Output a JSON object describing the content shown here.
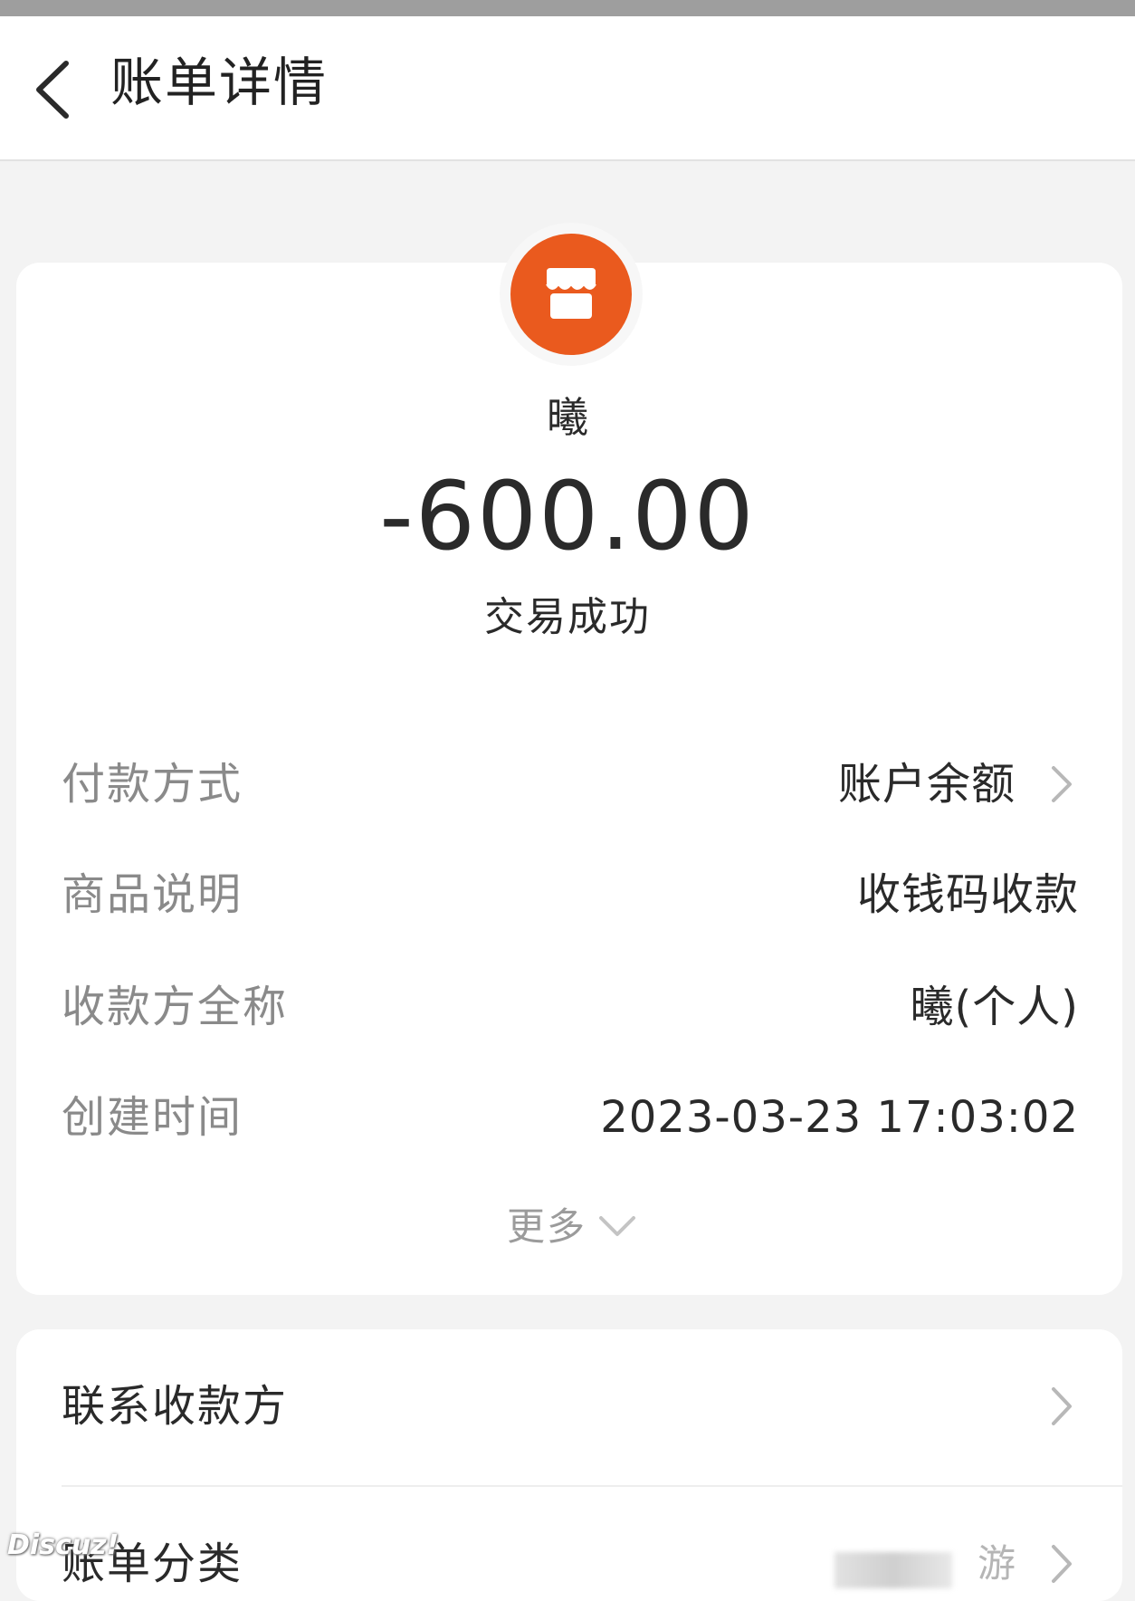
{
  "header": {
    "back_label": "",
    "title": "账单详情"
  },
  "summary": {
    "merchant_icon": "storefront-icon",
    "merchant_name": "曦",
    "amount": "-600.00",
    "status": "交易成功"
  },
  "details": [
    {
      "label": "付款方式",
      "value": "账户余额"
    },
    {
      "label": "商品说明",
      "value": "收钱码收款"
    },
    {
      "label": "收款方全称",
      "value": "曦(个人)"
    },
    {
      "label": "创建时间",
      "value": "2023-03-23 17:03:02"
    }
  ],
  "more_label": "更多",
  "actions": [
    {
      "label": "联系收款方"
    },
    {
      "label": "账单分类",
      "value": "游"
    }
  ],
  "watermark": "Discuz!",
  "colors": {
    "accent": "#ea5a1e",
    "background": "#f3f3f3",
    "card": "#ffffff"
  }
}
